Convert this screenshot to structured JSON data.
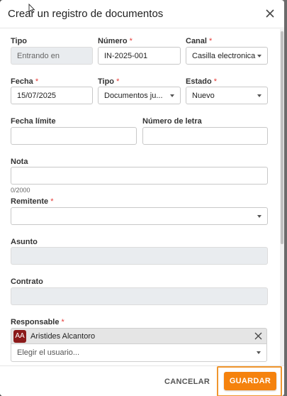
{
  "dialog": {
    "title": "Crear un registro de documentos"
  },
  "form": {
    "tipo": {
      "label": "Tipo",
      "value": "Entrando en"
    },
    "numero": {
      "label": "Número",
      "required_mark": "*",
      "value": "IN-2025-001"
    },
    "canal": {
      "label": "Canal",
      "required_mark": "*",
      "value": "Casilla electronica"
    },
    "fecha": {
      "label": "Fecha",
      "required_mark": "*",
      "value": "15/07/2025"
    },
    "tipo2": {
      "label": "Tipo",
      "required_mark": "*",
      "value": "Documentos ju..."
    },
    "estado": {
      "label": "Estado",
      "required_mark": "*",
      "value": "Nuevo"
    },
    "fecha_limite": {
      "label": "Fecha límite",
      "value": ""
    },
    "numero_letra": {
      "label": "Número de letra",
      "value": ""
    },
    "nota": {
      "label": "Nota",
      "value": "",
      "counter": "0/2000"
    },
    "remitente": {
      "label": "Remitente",
      "required_mark": "*",
      "value": ""
    },
    "asunto": {
      "label": "Asunto",
      "value": ""
    },
    "contrato": {
      "label": "Contrato",
      "value": ""
    },
    "responsable": {
      "label": "Responsable",
      "required_mark": "*",
      "selected_initials": "AA",
      "selected_name": "Aristides Alcantoro",
      "placeholder": "Elegir el usuario..."
    }
  },
  "footer": {
    "cancel_label": "CANCELAR",
    "save_label": "GUARDAR"
  },
  "colors": {
    "accent": "#f5820d",
    "required": "#e53935",
    "avatar": "#8b1a1a"
  },
  "icons": [
    "close-icon",
    "chevron-down-icon",
    "mouse-cursor-icon"
  ]
}
